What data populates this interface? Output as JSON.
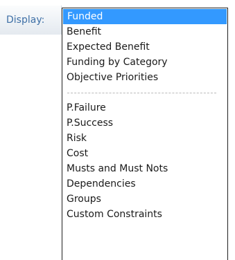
{
  "display": {
    "label": "Display:"
  },
  "dropdown": {
    "selected": "Funded",
    "groups": [
      {
        "items": [
          "Funded",
          "Benefit",
          "Expected Benefit",
          "Funding by Category",
          "Objective Priorities"
        ]
      },
      {
        "items": [
          "P.Failure",
          "P.Success",
          "Risk",
          "Cost",
          "Musts and Must Nots",
          "Dependencies",
          "Groups",
          "Custom Constraints"
        ]
      }
    ]
  },
  "colors": {
    "selection_bg": "#3399ff",
    "selection_text": "#ffffff",
    "label_text": "#3e6fa6",
    "item_text": "#1a1a1a"
  }
}
